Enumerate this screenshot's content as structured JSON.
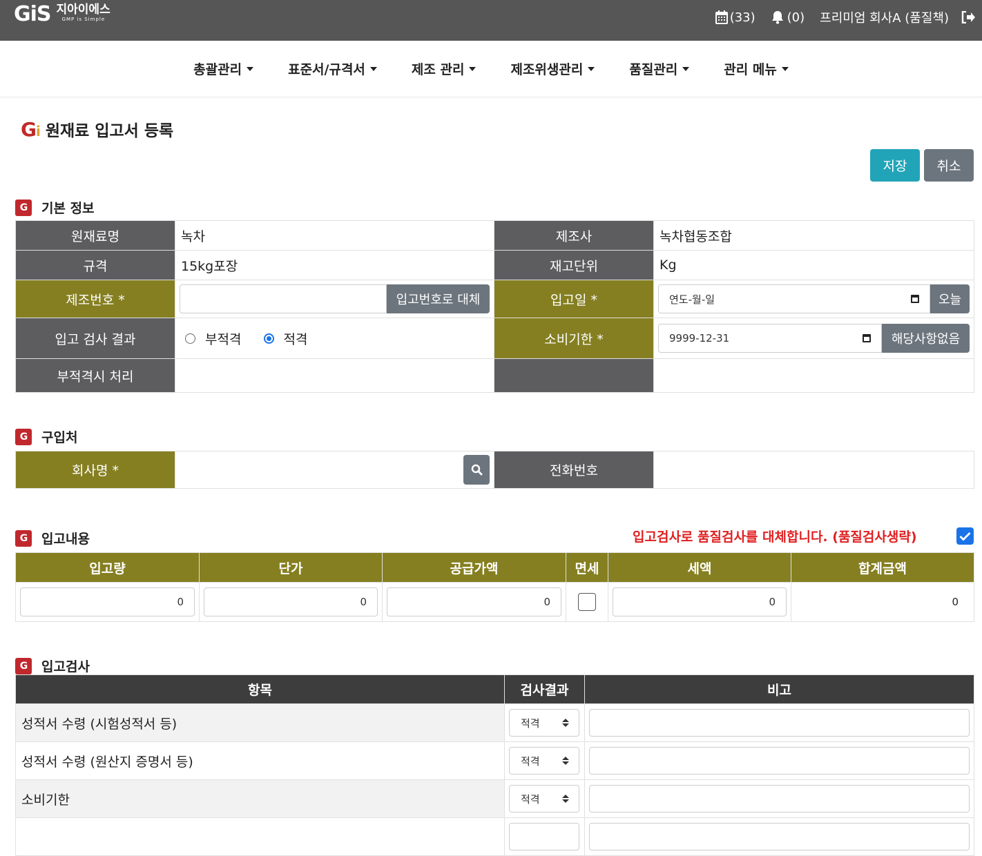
{
  "header": {
    "logo_mark": "GiS",
    "logo_name": "지아이에스",
    "logo_tagline": "GMP is Simple",
    "calendar_count": "(33)",
    "bell_count": "(0)",
    "user_label": "프리미엄 회사A (품질책)"
  },
  "nav": {
    "items": [
      {
        "label": "총괄관리"
      },
      {
        "label": "표준서/규격서"
      },
      {
        "label": "제조 관리"
      },
      {
        "label": "제조위생관리"
      },
      {
        "label": "품질관리"
      },
      {
        "label": "관리 메뉴"
      }
    ]
  },
  "page": {
    "title": "원재료 입고서 등록",
    "save_label": "저장",
    "cancel_label": "취소"
  },
  "basic": {
    "section_title": "기본 정보",
    "material_name_label": "원재료명",
    "material_name": "녹차",
    "maker_label": "제조사",
    "maker": "녹차협동조합",
    "spec_label": "규격",
    "spec": "15kg포장",
    "unit_label": "재고단위",
    "unit": "Kg",
    "lot_label": "제조번호 *",
    "lot_value": "",
    "lot_replace_label": "입고번호로 대체",
    "recv_date_label": "입고일 *",
    "recv_date_placeholder": "연도-월-일",
    "today_label": "오늘",
    "inspect_label": "입고 검사 결과",
    "radio_fail": "부적격",
    "radio_pass": "적격",
    "radio_selected": "적격",
    "expiry_label": "소비기한 *",
    "expiry_value": "9999-12-31",
    "na_label": "해당사항없음",
    "fail_handle_label": "부적격시 처리"
  },
  "supplier": {
    "section_title": "구입처",
    "company_label": "회사명 *",
    "company_value": "",
    "phone_label": "전화번호",
    "phone_value": ""
  },
  "receipt": {
    "section_title": "입고내용",
    "notice": "입고검사로 품질검사를 대체합니다. (품질검사생략)",
    "notice_checked": true,
    "columns": [
      "입고량",
      "단가",
      "공급가액",
      "면세",
      "세액",
      "합계금액"
    ],
    "qty": "0",
    "unit_price": "0",
    "supply": "0",
    "tax_free": false,
    "tax": "0",
    "total": "0"
  },
  "inspection": {
    "section_title": "입고검사",
    "columns": [
      "항목",
      "검사결과",
      "비고"
    ],
    "rows": [
      {
        "item": "성적서 수령 (시험성적서 등)",
        "result": "적격",
        "note": ""
      },
      {
        "item": "성적서 수령 (원산지 증명서 등)",
        "result": "적격",
        "note": ""
      },
      {
        "item": "소비기한",
        "result": "적격",
        "note": ""
      },
      {
        "item": "",
        "result": "",
        "note": ""
      }
    ]
  }
}
